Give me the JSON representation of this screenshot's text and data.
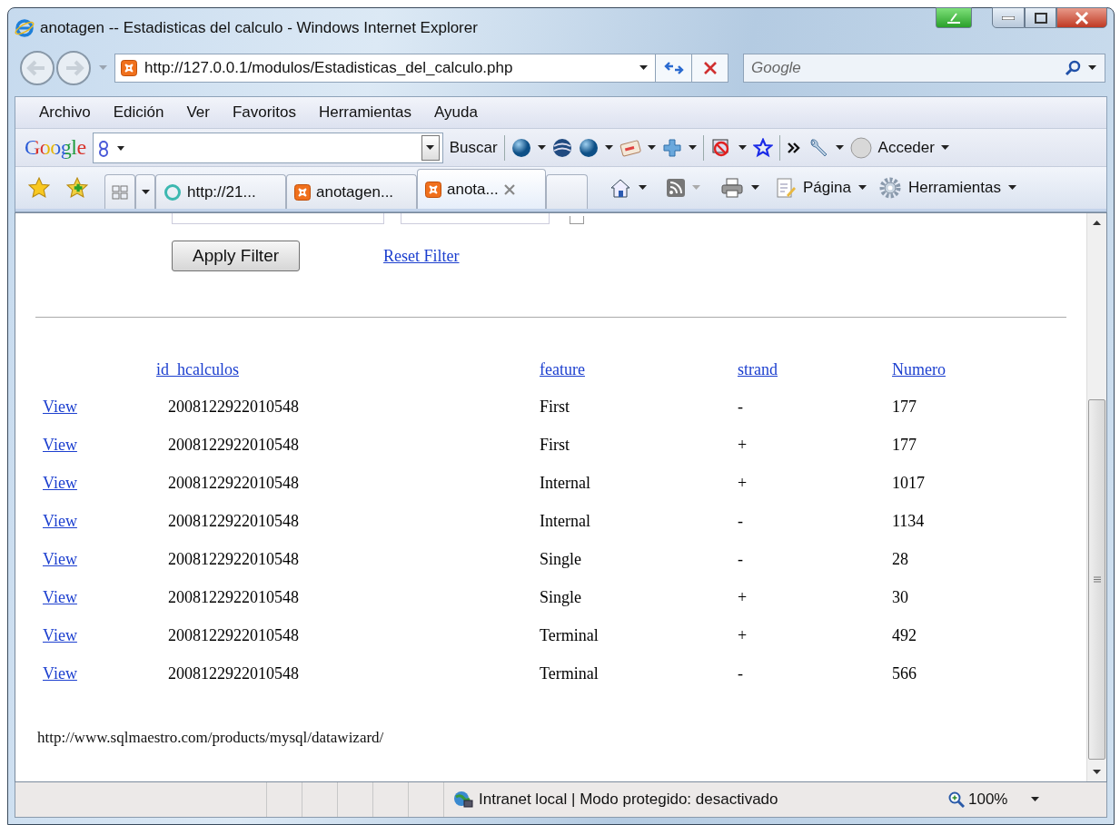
{
  "window": {
    "title": "anotagen -- Estadisticas del calculo - Windows Internet Explorer"
  },
  "address_bar": {
    "url": "http://127.0.0.1/modulos/Estadisticas_del_calculo.php"
  },
  "search": {
    "placeholder": "Google"
  },
  "menu": [
    "Archivo",
    "Edición",
    "Ver",
    "Favoritos",
    "Herramientas",
    "Ayuda"
  ],
  "google_toolbar": {
    "logo": "Google",
    "search_button": "Buscar",
    "sign_in": "Acceder"
  },
  "tabs": [
    {
      "label": "http://21...",
      "selected": false,
      "kind": "web"
    },
    {
      "label": "anotagen...",
      "selected": false,
      "kind": "xampp"
    },
    {
      "label": "anota...",
      "selected": true,
      "kind": "xampp"
    }
  ],
  "command_bar": {
    "page": "Página",
    "tools": "Herramientas"
  },
  "filter": {
    "apply_button": "Apply Filter",
    "reset_link": "Reset Filter",
    "option_checked": false
  },
  "table": {
    "columns": [
      "id_hcalculos",
      "feature",
      "strand",
      "Numero"
    ],
    "rows": [
      {
        "action": "View",
        "cells": [
          "2008122922010548",
          "First",
          "-",
          "177"
        ]
      },
      {
        "action": "View",
        "cells": [
          "2008122922010548",
          "First",
          "+",
          "177"
        ]
      },
      {
        "action": "View",
        "cells": [
          "2008122922010548",
          "Internal",
          "+",
          "1017"
        ]
      },
      {
        "action": "View",
        "cells": [
          "2008122922010548",
          "Internal",
          "-",
          "1134"
        ]
      },
      {
        "action": "View",
        "cells": [
          "2008122922010548",
          "Single",
          "-",
          "28"
        ]
      },
      {
        "action": "View",
        "cells": [
          "2008122922010548",
          "Single",
          "+",
          "30"
        ]
      },
      {
        "action": "View",
        "cells": [
          "2008122922010548",
          "Terminal",
          "+",
          "492"
        ]
      },
      {
        "action": "View",
        "cells": [
          "2008122922010548",
          "Terminal",
          "-",
          "566"
        ]
      }
    ]
  },
  "footer_url": "http://www.sqlmaestro.com/products/mysql/datawizard/",
  "status_bar": {
    "zone": "Intranet local | Modo protegido: desactivado",
    "zoom": "100%"
  }
}
